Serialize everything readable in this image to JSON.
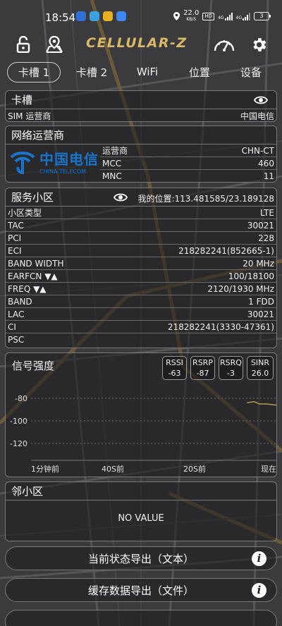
{
  "status_bar": {
    "time": "18:54",
    "net_speed": "22.0",
    "net_speed_unit": "KB/S",
    "hd_label": "HD",
    "sim1_type": "4G",
    "sim2_type": "4G",
    "battery_level": "3"
  },
  "toolbar": {
    "logo_text": "CELLULAR-Z"
  },
  "tabs": [
    {
      "label": "卡槽 1",
      "active": true
    },
    {
      "label": "卡槽 2",
      "active": false
    },
    {
      "label": "WiFi",
      "active": false
    },
    {
      "label": "位置",
      "active": false
    },
    {
      "label": "设备",
      "active": false
    }
  ],
  "sim_card": {
    "title": "卡槽",
    "label": "SIM 运营商",
    "value": "中国电信"
  },
  "operator": {
    "title": "网络运营商",
    "logo_cn": "中国电信",
    "logo_en": "CHINA TELECOM",
    "rows": [
      {
        "label": "运营商",
        "value": "CHN-CT"
      },
      {
        "label": "MCC",
        "value": "460"
      },
      {
        "label": "MNC",
        "value": "11"
      }
    ]
  },
  "serving_cell": {
    "title": "服务小区",
    "location": "我的位置:113.481585/23.189128",
    "rows": [
      {
        "label": "小区类型",
        "value": "LTE"
      },
      {
        "label": "TAC",
        "value": "30021"
      },
      {
        "label": "PCI",
        "value": "228"
      },
      {
        "label": "ECI",
        "value": "218282241(852665-1)"
      },
      {
        "label": "BAND WIDTH",
        "value": "20 MHz"
      },
      {
        "label": "EARFCN ▼▲",
        "value": "100/18100"
      },
      {
        "label": "FREQ ▼▲",
        "value": "2120/1930 MHz"
      },
      {
        "label": "BAND",
        "value": "1 FDD"
      },
      {
        "label": "LAC",
        "value": "30021"
      },
      {
        "label": "CI",
        "value": "218282241(3330-47361)"
      },
      {
        "label": "PSC",
        "value": ""
      }
    ]
  },
  "signal": {
    "title": "信号强度",
    "chips": [
      {
        "name": "RSSI",
        "value": "-63"
      },
      {
        "name": "RSRP",
        "value": "-87"
      },
      {
        "name": "RSRQ",
        "value": "-3"
      },
      {
        "name": "SINR",
        "value": "26.0"
      }
    ],
    "line_color": "#b59a55"
  },
  "chart_data": {
    "type": "line",
    "title": "信号强度",
    "x": [
      "1分钟前",
      "40S前",
      "20S前",
      "现在"
    ],
    "ytick_labels": [
      "-80",
      "-100",
      "-120"
    ],
    "yticks": [
      -80,
      -100,
      -120
    ],
    "ylim": [
      -135,
      -70
    ],
    "series": [
      {
        "name": "RSRP",
        "points": [
          [
            0.88,
            -84
          ],
          [
            0.91,
            -83
          ],
          [
            0.93,
            -85
          ],
          [
            0.96,
            -85
          ],
          [
            1.0,
            -86
          ]
        ]
      }
    ]
  },
  "neighbor": {
    "title": "邻小区",
    "empty_text": "NO VALUE"
  },
  "actions": {
    "export_text": "当前状态导出（文本）",
    "export_file": "缓存数据导出（文件）"
  }
}
